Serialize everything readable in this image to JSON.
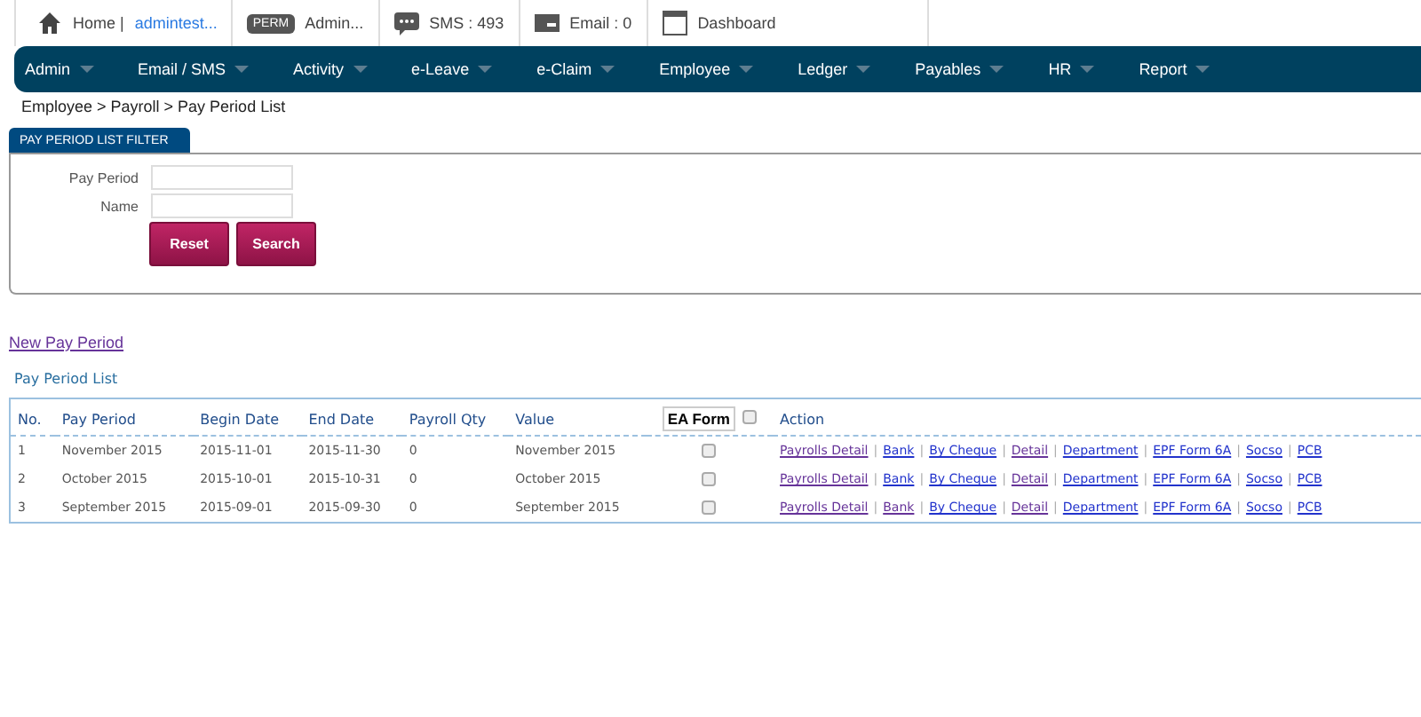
{
  "top_bar": [
    {
      "kind": "home",
      "text": "Home | ",
      "link": "admintest..."
    },
    {
      "kind": "perm",
      "badge": "PERM",
      "text": "Admin..."
    },
    {
      "kind": "sms",
      "text": "SMS : 493"
    },
    {
      "kind": "email",
      "text": "Email : 0"
    },
    {
      "kind": "dashboard",
      "text": "Dashboard"
    }
  ],
  "menu": [
    "Admin",
    "Email / SMS",
    "Activity",
    "e-Leave",
    "e-Claim",
    "Employee",
    "Ledger",
    "Payables",
    "HR",
    "Report"
  ],
  "breadcrumb": "Employee > Payroll > Pay Period List",
  "filter": {
    "title": "PAY PERIOD LIST FILTER",
    "fields": [
      {
        "label": "Pay Period"
      },
      {
        "label": "Name"
      }
    ],
    "buttons": [
      "Reset",
      "Search"
    ]
  },
  "new_link": "New Pay Period",
  "list_title": "Pay Period List",
  "table": {
    "columns": [
      "No.",
      "Pay Period",
      "Begin Date",
      "End Date",
      "Payroll Qty",
      "Value",
      "EA Form",
      "Action"
    ],
    "header_checked": false,
    "rows": [
      {
        "cells": [
          "1",
          "November 2015",
          "2015-11-01",
          "2015-11-30",
          "0",
          "November 2015"
        ],
        "checked": false,
        "actions": [
          {
            "label": "Payrolls Detail",
            "visited": true
          },
          {
            "sep": "|",
            "label": "Bank",
            "visited": false
          },
          {
            "sep": "|",
            "label": "By Cheque",
            "visited": false
          },
          {
            "sep": "|",
            "label": "Detail",
            "visited": true
          },
          {
            "sep": "|",
            "label": "Department",
            "visited": false
          },
          {
            "sep": "|",
            "label": "EPF Form 6A",
            "visited": false
          },
          {
            "sep": "|",
            "label": "Socso",
            "visited": false
          },
          {
            "sep": "|",
            "label": "PCB",
            "visited": false
          }
        ]
      },
      {
        "cells": [
          "2",
          "October 2015",
          "2015-10-01",
          "2015-10-31",
          "0",
          "October 2015"
        ],
        "checked": false,
        "actions": [
          {
            "label": "Payrolls Detail",
            "visited": true
          },
          {
            "sep": "|",
            "label": "Bank",
            "visited": false
          },
          {
            "sep": "|",
            "label": "By Cheque",
            "visited": false
          },
          {
            "sep": "|",
            "label": "Detail",
            "visited": true
          },
          {
            "sep": "|",
            "label": "Department",
            "visited": false
          },
          {
            "sep": "|",
            "label": "EPF Form 6A",
            "visited": false
          },
          {
            "sep": "|",
            "label": "Socso",
            "visited": false
          },
          {
            "sep": "|",
            "label": "PCB",
            "visited": false
          }
        ]
      },
      {
        "cells": [
          "3",
          "September 2015",
          "2015-09-01",
          "2015-09-30",
          "0",
          "September 2015"
        ],
        "checked": false,
        "actions": [
          {
            "label": "Payrolls Detail",
            "visited": true
          },
          {
            "sep": "|",
            "label": "Bank",
            "visited": true
          },
          {
            "sep": "|",
            "label": "By Cheque",
            "visited": false
          },
          {
            "sep": "|",
            "label": "Detail",
            "visited": true
          },
          {
            "sep": "|",
            "label": "Department",
            "visited": false
          },
          {
            "sep": "|",
            "label": "EPF Form 6A",
            "visited": false
          },
          {
            "sep": "|",
            "label": "Socso",
            "visited": false
          },
          {
            "sep": "|",
            "label": "PCB",
            "visited": false
          }
        ]
      }
    ]
  }
}
